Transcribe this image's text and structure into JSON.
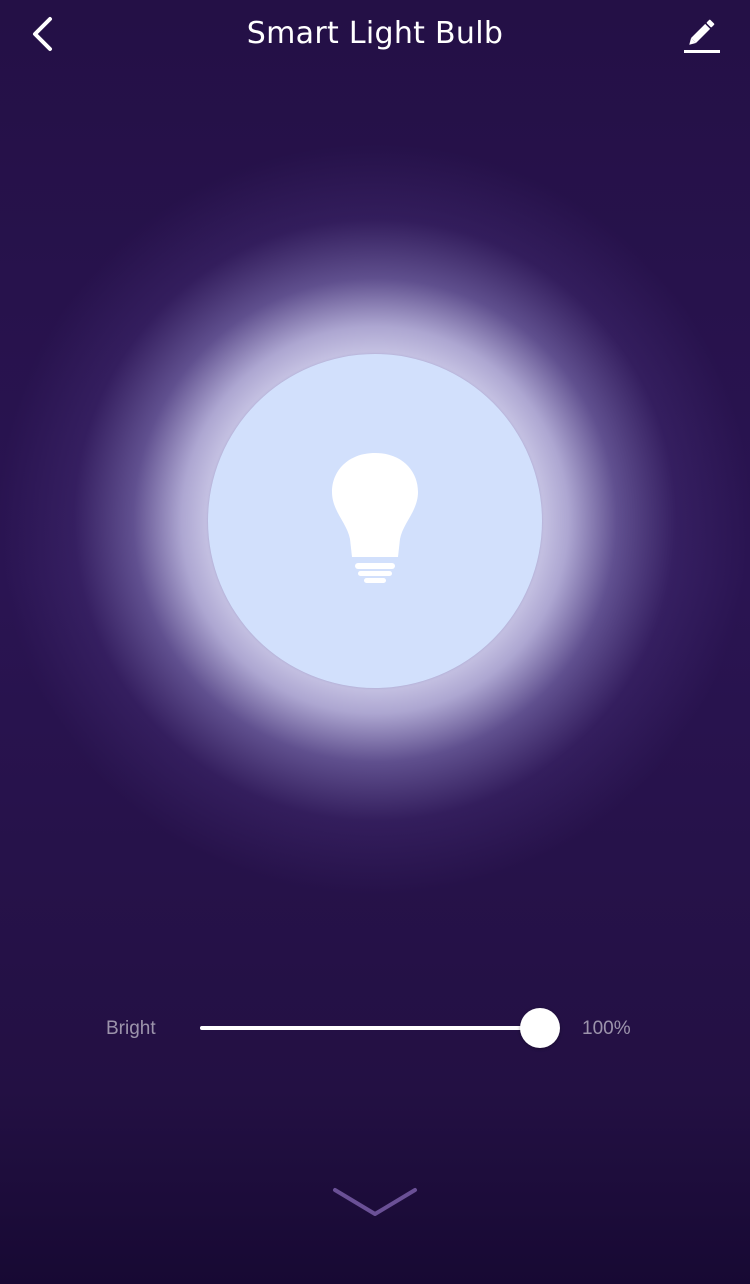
{
  "header": {
    "title": "Smart Light Bulb",
    "back_icon": "chevron-left-icon",
    "edit_icon": "pencil-icon"
  },
  "bulb": {
    "icon": "lightbulb-icon",
    "state": "on",
    "circle_color": "#d2e0fc",
    "glow_color": "#ececfc"
  },
  "brightness": {
    "label": "Bright",
    "value": 100,
    "value_text": "100%"
  },
  "footer": {
    "expand_icon": "chevron-down-icon"
  },
  "colors": {
    "background": "#2a1452",
    "background_bottom": "#170933",
    "text": "#ffffff"
  }
}
